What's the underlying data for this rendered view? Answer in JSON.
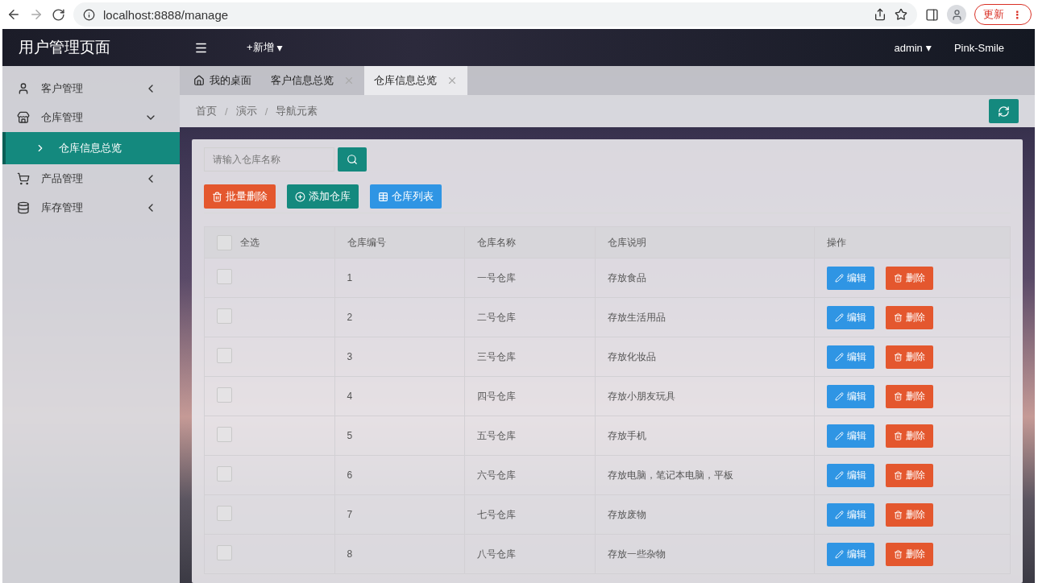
{
  "browser": {
    "url": "localhost:8888/manage",
    "update_label": "更新",
    "menu_glyph": "⋮"
  },
  "header": {
    "title": "用户管理页面",
    "add_label": "+新增",
    "add_caret": "▾",
    "user": "admin",
    "user_caret": "▾",
    "theme": "Pink-Smile"
  },
  "sidebar": {
    "items": [
      {
        "label": "客户管理",
        "expanded": false
      },
      {
        "label": "仓库管理",
        "expanded": true,
        "children": [
          {
            "label": "仓库信息总览",
            "selected": true
          }
        ]
      },
      {
        "label": "产品管理",
        "expanded": false
      },
      {
        "label": "库存管理",
        "expanded": false
      }
    ]
  },
  "tabs": [
    {
      "label": "我的桌面",
      "kind": "home",
      "selected": false
    },
    {
      "label": "客户信息总览",
      "kind": "page",
      "selected": false
    },
    {
      "label": "仓库信息总览",
      "kind": "page",
      "selected": true
    }
  ],
  "breadcrumb": {
    "separator": "/",
    "items": [
      "首页",
      "演示",
      "导航元素"
    ]
  },
  "search": {
    "placeholder": "请输入仓库名称"
  },
  "toolbar": [
    {
      "label": "批量删除",
      "kind": "danger"
    },
    {
      "label": "添加仓库",
      "kind": "primary"
    },
    {
      "label": "仓库列表",
      "kind": "info"
    }
  ],
  "table": {
    "select_all": {
      "label": "全选",
      "checked": false
    },
    "columns": [
      "仓库编号",
      "仓库名称",
      "仓库说明",
      "操作"
    ],
    "rows": [
      {
        "checked": false,
        "id": "1",
        "name": "一号仓库",
        "desc": "存放食品",
        "edit": "编辑",
        "delete": "删除"
      },
      {
        "checked": false,
        "id": "2",
        "name": "二号仓库",
        "desc": "存放生活用品",
        "edit": "编辑",
        "delete": "删除"
      },
      {
        "checked": false,
        "id": "3",
        "name": "三号仓库",
        "desc": "存放化妆品",
        "edit": "编辑",
        "delete": "删除"
      },
      {
        "checked": false,
        "id": "4",
        "name": "四号仓库",
        "desc": "存放小朋友玩具",
        "edit": "编辑",
        "delete": "删除"
      },
      {
        "checked": false,
        "id": "5",
        "name": "五号仓库",
        "desc": "存放手机",
        "edit": "编辑",
        "delete": "删除"
      },
      {
        "checked": false,
        "id": "6",
        "name": "六号仓库",
        "desc": "存放电脑，笔记本电脑，平板",
        "edit": "编辑",
        "delete": "删除"
      },
      {
        "checked": false,
        "id": "7",
        "name": "七号仓库",
        "desc": "存放废物",
        "edit": "编辑",
        "delete": "删除"
      },
      {
        "checked": false,
        "id": "8",
        "name": "八号仓库",
        "desc": "存放一些杂物",
        "edit": "编辑",
        "delete": "删除"
      }
    ]
  }
}
